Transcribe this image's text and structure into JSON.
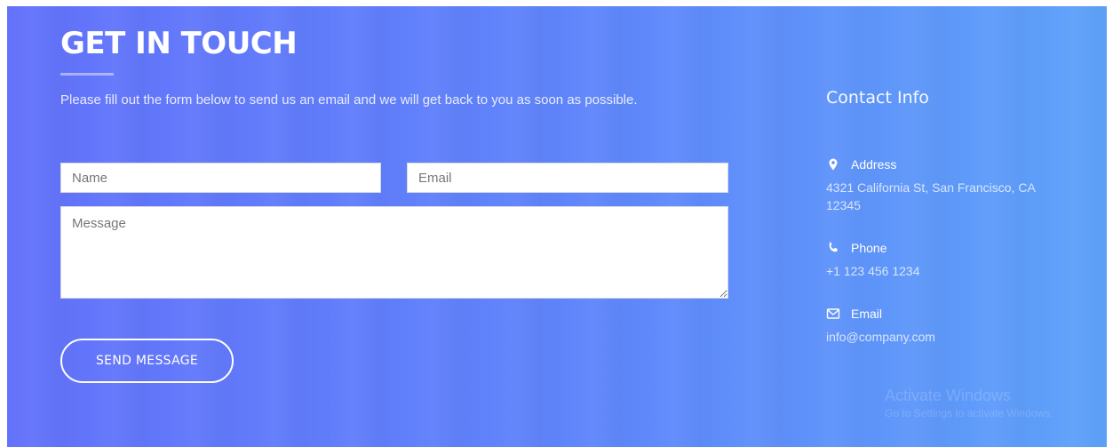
{
  "header": {
    "title": "GET IN TOUCH",
    "intro": "Please fill out the form below to send us an email and we will get back to you as soon as possible."
  },
  "form": {
    "name_placeholder": "Name",
    "email_placeholder": "Email",
    "message_placeholder": "Message",
    "send_label": "SEND MESSAGE"
  },
  "contact": {
    "heading": "Contact Info",
    "address_label": "Address",
    "address_value": "4321 California St, San Francisco, CA 12345",
    "phone_label": "Phone",
    "phone_value": "+1 123 456 1234",
    "email_label": "Email",
    "email_value": "info@company.com"
  },
  "watermark": {
    "line1": "Activate Windows",
    "line2": "Go to Settings to activate Windows."
  },
  "icons": {
    "address": "map-marker-icon",
    "phone": "phone-icon",
    "email": "envelope-icon"
  },
  "colors": {
    "gradient_start": "#6372fb",
    "gradient_end": "#5ea2fa",
    "text": "#ffffff"
  }
}
